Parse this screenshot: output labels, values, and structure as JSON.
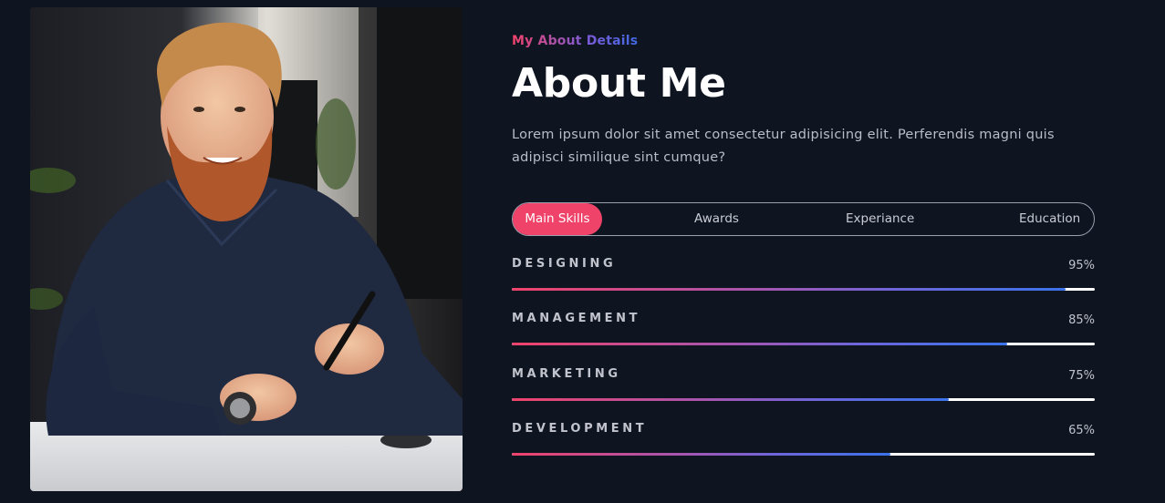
{
  "photo": {
    "alt": "Smiling bearded man in a dark shirt sitting at a desk holding a pen"
  },
  "about": {
    "eyebrow": "My About Details",
    "title": "About Me",
    "description": "Lorem ipsum dolor sit amet consectetur adipisicing elit. Perferendis magni quis adipisci similique sint cumque?"
  },
  "tabs": [
    {
      "label": "Main Skills",
      "active": true
    },
    {
      "label": "Awards",
      "active": false
    },
    {
      "label": "Experiance",
      "active": false
    },
    {
      "label": "Education",
      "active": false
    }
  ],
  "skills": [
    {
      "name": "DESIGNING",
      "percent_label": "95%",
      "level": 0.95
    },
    {
      "name": "MANAGEMENT",
      "percent_label": "85%",
      "level": 0.85
    },
    {
      "name": "MARKETING",
      "percent_label": "75%",
      "level": 0.75
    },
    {
      "name": "DEVELOPMENT",
      "percent_label": "65%",
      "level": 0.65
    }
  ],
  "colors": {
    "background": "#0f1421",
    "accent": "#f0436a",
    "gradient_end": "#3b73ea",
    "track": "#ffffff"
  }
}
